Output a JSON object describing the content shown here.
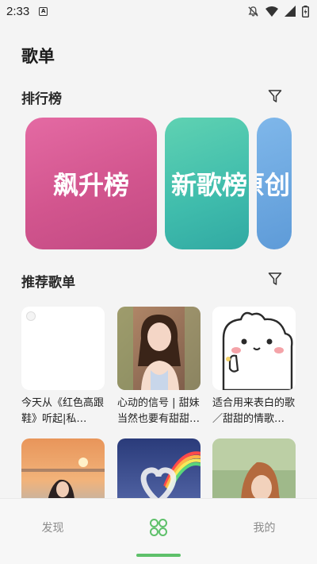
{
  "status_bar": {
    "time": "2:33",
    "sim_label": "A"
  },
  "page": {
    "title": "歌单"
  },
  "rank_section": {
    "title": "排行榜",
    "cards": [
      {
        "label": "飙升榜"
      },
      {
        "label": "新歌榜"
      },
      {
        "label": "原创"
      }
    ]
  },
  "recommend_section": {
    "title": "推荐歌单",
    "playlists": [
      {
        "name": "今天从《红色高跟鞋》听起|私…"
      },
      {
        "name": "心动的信号 | 甜妹当然也要有甜甜…"
      },
      {
        "name": "适合用来表白的歌／甜甜的情歌…"
      },
      {
        "name": ""
      },
      {
        "name": ""
      },
      {
        "name": ""
      }
    ]
  },
  "bottom_nav": {
    "items": [
      {
        "label": "发现"
      },
      {
        "label": "",
        "icon": "grid-icon"
      },
      {
        "label": "我的"
      }
    ],
    "accent": "#5ec06a"
  }
}
